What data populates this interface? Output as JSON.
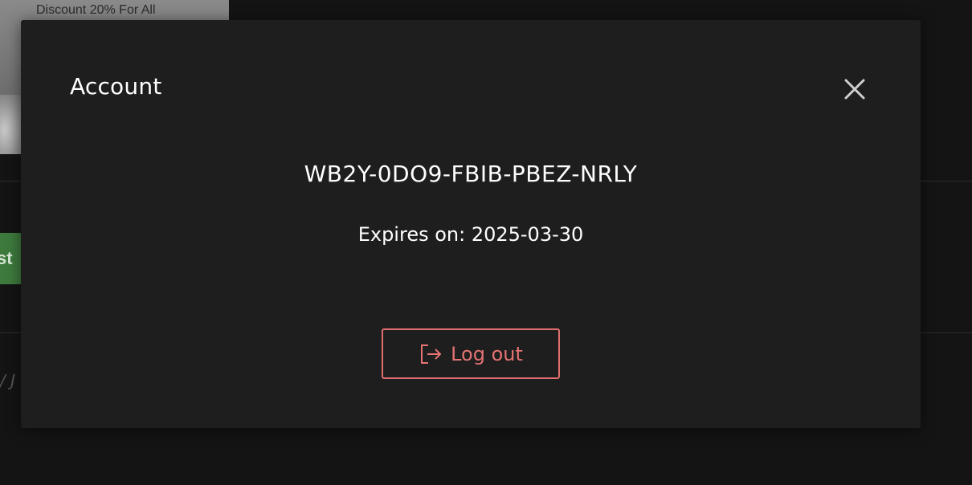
{
  "background": {
    "banner_text": "Discount 20% For All",
    "green_button_label": "st",
    "faint_text": "/ J"
  },
  "modal": {
    "title": "Account",
    "close_icon": "close-icon",
    "account_key": "WB2Y-0DO9-FBIB-PBEZ-NRLY",
    "expires": "Expires on: 2025-03-30",
    "logout_label": "Log out",
    "logout_icon": "logout-icon"
  },
  "colors": {
    "modal_background": "#1e1e1e",
    "page_background": "#141414",
    "text": "#ffffff",
    "danger_accent": "#e57373",
    "background_button_green": "#3d7a3c"
  }
}
